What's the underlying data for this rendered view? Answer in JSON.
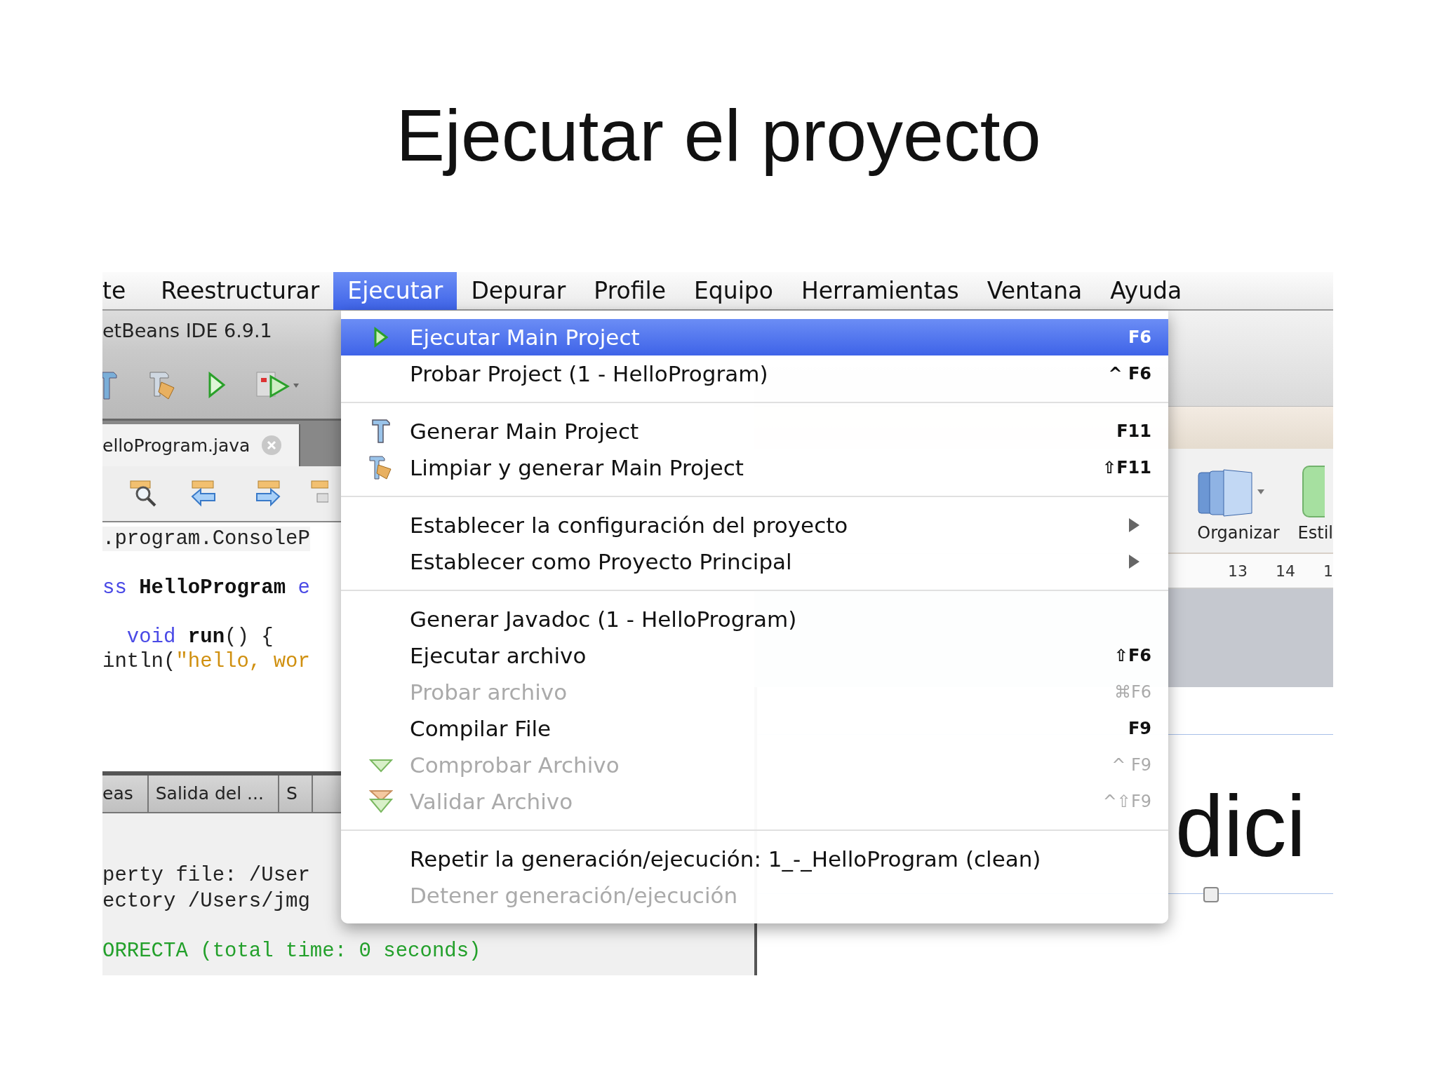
{
  "slide": {
    "title": "Ejecutar el proyecto"
  },
  "menubar": [
    {
      "label": "te",
      "selected": false
    },
    {
      "label": "Reestructurar",
      "selected": false
    },
    {
      "label": "Ejecutar",
      "selected": true
    },
    {
      "label": "Depurar",
      "selected": false
    },
    {
      "label": "Profile",
      "selected": false
    },
    {
      "label": "Equipo",
      "selected": false
    },
    {
      "label": "Herramientas",
      "selected": false
    },
    {
      "label": "Ventana",
      "selected": false
    },
    {
      "label": "Ayuda",
      "selected": false
    }
  ],
  "ide": {
    "window_title": "etBeans IDE 6.9.1",
    "editor_tab": "elloProgram.java",
    "code_lines": [
      {
        "highlighted": true,
        "segments": [
          {
            "text": ".program.ConsoleP",
            "kind": "plain"
          }
        ]
      },
      {
        "highlighted": false,
        "segments": [
          {
            "text": "ss",
            "kind": "keyword"
          },
          {
            "text": " HelloProgram ",
            "kind": "name"
          },
          {
            "text": "e",
            "kind": "keyword"
          }
        ]
      },
      {
        "highlighted": false,
        "segments": [
          {
            "text": "  void",
            "kind": "keyword"
          },
          {
            "text": " run",
            "kind": "name"
          },
          {
            "text": "() {",
            "kind": "plain"
          }
        ]
      },
      {
        "highlighted": false,
        "segments": [
          {
            "text": "intln(",
            "kind": "plain"
          },
          {
            "text": "\"hello, wor",
            "kind": "string"
          }
        ]
      }
    ],
    "output_tabs": [
      {
        "label": "eas"
      },
      {
        "label": "Salida del ..."
      },
      {
        "label": "S"
      }
    ],
    "output_lines": [
      {
        "text": "perty file: /User",
        "kind": "plain"
      },
      {
        "text": "ectory /Users/jmg",
        "kind": "plain"
      },
      {
        "text": "ORRECTA (total time: 0 seconds)",
        "kind": "success"
      }
    ]
  },
  "menu": {
    "items": [
      {
        "kind": "item",
        "label": "Ejecutar Main Project",
        "shortcut": "F6",
        "selected": true,
        "disabled": false,
        "submenu": false
      },
      {
        "kind": "item",
        "label": "Probar Project (1 - HelloProgram)",
        "shortcut": "^ F6",
        "selected": false,
        "disabled": false,
        "submenu": false
      },
      {
        "kind": "separator"
      },
      {
        "kind": "item",
        "label": "Generar Main Project",
        "shortcut": "F11",
        "selected": false,
        "disabled": false,
        "submenu": false
      },
      {
        "kind": "item",
        "label": "Limpiar y generar Main Project",
        "shortcut": "⇧F11",
        "selected": false,
        "disabled": false,
        "submenu": false
      },
      {
        "kind": "separator"
      },
      {
        "kind": "item",
        "label": "Establecer la configuración del proyecto",
        "selected": false,
        "disabled": false,
        "submenu": true
      },
      {
        "kind": "item",
        "label": "Establecer como Proyecto Principal",
        "selected": false,
        "disabled": false,
        "submenu": true
      },
      {
        "kind": "separator"
      },
      {
        "kind": "item",
        "label": "Generar Javadoc (1 - HelloProgram)",
        "selected": false,
        "disabled": false,
        "submenu": false
      },
      {
        "kind": "item",
        "label": "Ejecutar archivo",
        "shortcut": "⇧F6",
        "selected": false,
        "disabled": false,
        "submenu": false
      },
      {
        "kind": "item",
        "label": "Probar archivo",
        "shortcut": "⌘F6",
        "selected": false,
        "disabled": true,
        "submenu": false
      },
      {
        "kind": "item",
        "label": "Compilar File",
        "shortcut": "F9",
        "selected": false,
        "disabled": false,
        "submenu": false
      },
      {
        "kind": "item",
        "label": "Comprobar Archivo",
        "shortcut": "^ F9",
        "selected": false,
        "disabled": true,
        "submenu": false
      },
      {
        "kind": "item",
        "label": "Validar Archivo",
        "shortcut": "^⇧F9",
        "selected": false,
        "disabled": true,
        "submenu": false
      },
      {
        "kind": "separator"
      },
      {
        "kind": "item",
        "label": "Repetir la generación/ejecución: 1_-_HelloProgram (clean)",
        "selected": false,
        "disabled": false,
        "submenu": false
      },
      {
        "kind": "item",
        "label": "Detener generación/ejecución",
        "selected": false,
        "disabled": true,
        "submenu": false
      }
    ]
  },
  "document": {
    "ribbon": [
      {
        "label": "Organizar"
      },
      {
        "label": "Estil"
      }
    ],
    "ruler": [
      "13",
      "14",
      "1"
    ],
    "body_text": "dici"
  }
}
